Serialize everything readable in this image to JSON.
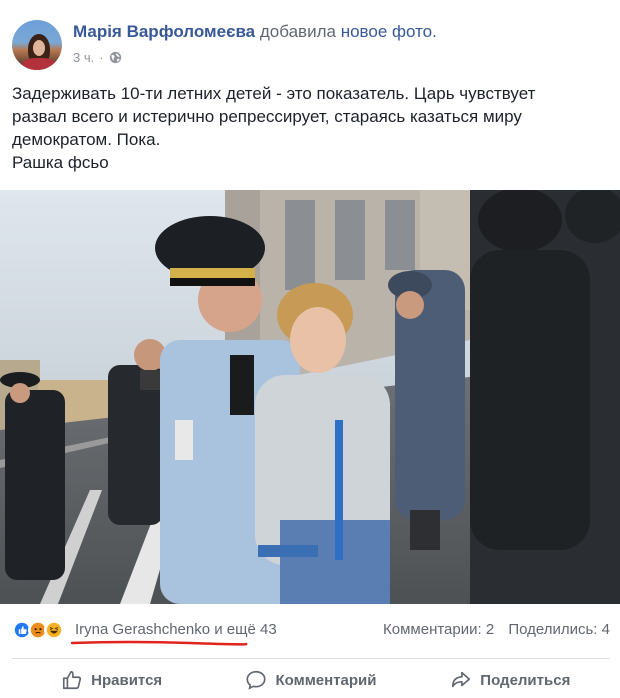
{
  "post": {
    "author": {
      "name": "Марія Варфоломеєва",
      "action": "добавила",
      "action_link": "новое фото."
    },
    "meta": {
      "time": "3 ч.",
      "privacy_icon": "globe-icon"
    },
    "text_lines": [
      "Задерживать 10-ти летних детей - это показатель. Царь чувствует",
      "развал всего и истерично репрессирует, стараясь казаться миру",
      "демократом. Пока.",
      "Рашка фсьо"
    ],
    "reactions": {
      "icons": [
        "like-icon",
        "angry-icon",
        "haha-icon"
      ],
      "likers_text": "Iryna Gerashchenko и ещё 43",
      "comments": "Комментарии: 2",
      "shares": "Поделились: 4"
    },
    "actions": {
      "like": "Нравится",
      "comment": "Комментарий",
      "share": "Поделиться"
    },
    "colors": {
      "link": "#385898",
      "secondary_text": "#616770",
      "like_blue": "#2078f4",
      "angry_orange": "#e9710f",
      "haha_yellow": "#f7b125",
      "annotation_red": "#e0241b"
    }
  }
}
